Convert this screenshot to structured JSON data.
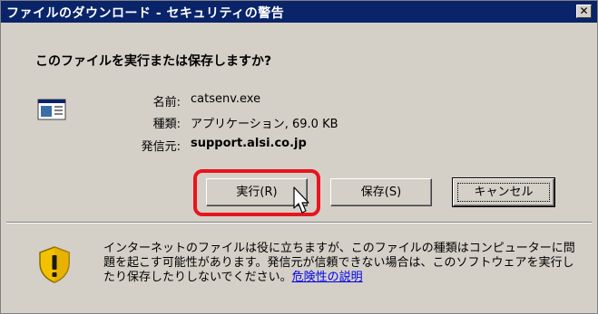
{
  "window": {
    "title": "ファイルのダウンロード - セキュリティの警告",
    "close_glyph": "✕"
  },
  "prompt": {
    "question": "このファイルを実行または保存しますか?"
  },
  "file": {
    "icon": "application-file-icon",
    "name_label": "名前:",
    "name_value": "catsenv.exe",
    "type_label": "種類:",
    "type_value": "アプリケーション, 69.0 KB",
    "from_label": "発信元:",
    "from_value": "support.alsi.co.jp"
  },
  "buttons": {
    "run": "実行(R)",
    "save": "保存(S)",
    "cancel": "キャンセル"
  },
  "warning": {
    "icon": "security-shield-icon",
    "text": "インターネットのファイルは役に立ちますが、このファイルの種類はコンピューターに問題を起こす可能性があります。発信元が信頼できない場合は、このソフトウェアを実行したり保存したりしないでください。",
    "link": "危険性の説明"
  },
  "colors": {
    "titlebar": "#0a246a",
    "dialog_bg": "#d4d0c8",
    "highlight": "#e8141e",
    "link": "#0000ee"
  }
}
